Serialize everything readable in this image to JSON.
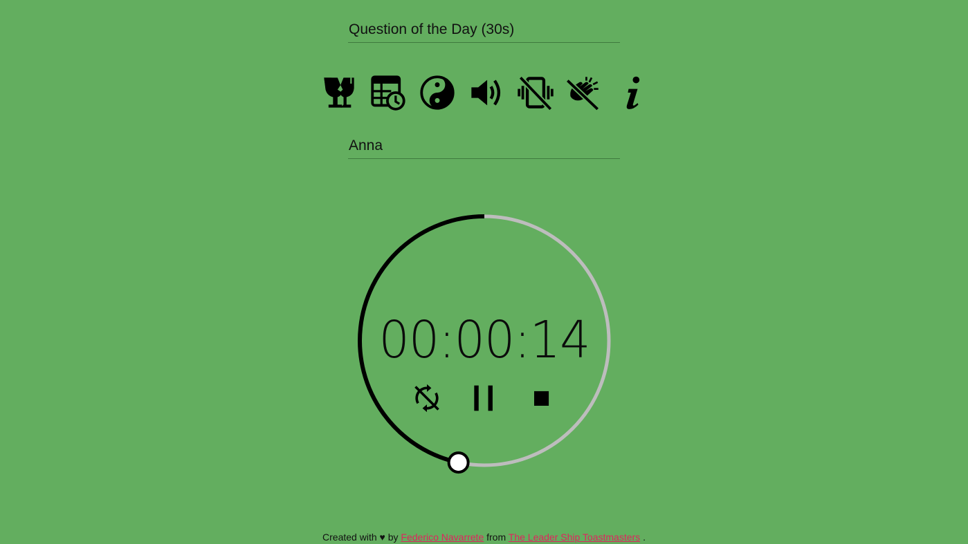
{
  "header": {
    "title_value": "Question of the Day (30s)"
  },
  "toolbar": {
    "icons": [
      "broken-glass-icon",
      "schedule-table-icon",
      "yin-yang-icon",
      "volume-icon",
      "vibration-off-icon",
      "clapping-off-icon",
      "info-icon"
    ]
  },
  "speaker": {
    "name_value": "Anna"
  },
  "timer": {
    "display": "00:00:14",
    "elapsed_seconds": 14,
    "total_seconds": 30,
    "progress_fraction": 0.4667,
    "controls": [
      "sync-off-icon",
      "pause-icon",
      "stop-icon"
    ]
  },
  "footer": {
    "prefix": "Created with ♥ by",
    "author_link": "Federico Navarrete",
    "middle": "from",
    "club_link": "The Leader Ship Toastmasters",
    "suffix": "."
  },
  "colors": {
    "background": "#63ae5f",
    "progress": "#000000",
    "track": "#bdbdbd",
    "link": "#e0245e"
  }
}
